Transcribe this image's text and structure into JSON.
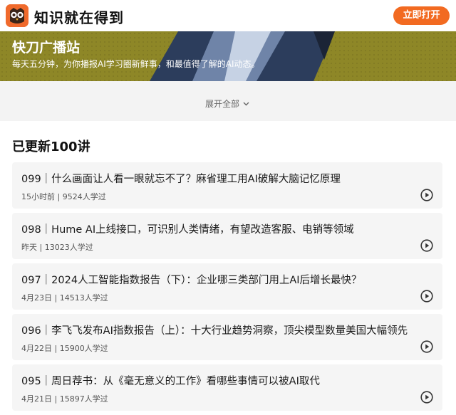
{
  "header": {
    "brand": "知识就在得到",
    "open_button": "立即打开",
    "logo_icon": "owl-logo-icon"
  },
  "banner": {
    "title": "快刀广播站",
    "description": "每天五分钟，为你播报AI学习圈新鲜事，和最值得了解的AI动态。"
  },
  "expand": {
    "label": "展开全部"
  },
  "section": {
    "count_title": "已更新100讲"
  },
  "episodes": [
    {
      "title": "099｜什么画面让人看一眼就忘不了？麻省理工用AI破解大脑记忆原理",
      "meta": "15小时前 | 9524人学过"
    },
    {
      "title": "098｜Hume AI上线接口，可识别人类情绪，有望改造客服、电销等领域",
      "meta": "昨天 | 13023人学过"
    },
    {
      "title": "097｜2024人工智能指数报告（下）：企业哪三类部门用上AI后增长最快？",
      "meta": "4月23日 | 14513人学过"
    },
    {
      "title": "096｜李飞飞发布AI指数报告（上）：十大行业趋势洞察，顶尖模型数量美国大幅领先",
      "meta": "4月22日 | 15900人学过"
    },
    {
      "title": "095｜周日荐书：从《毫无意义的工作》看哪些事情可以被AI取代",
      "meta": "4月21日 | 15897人学过"
    }
  ],
  "colors": {
    "accent": "#f26a21",
    "banner_bg": "#8c8426"
  }
}
